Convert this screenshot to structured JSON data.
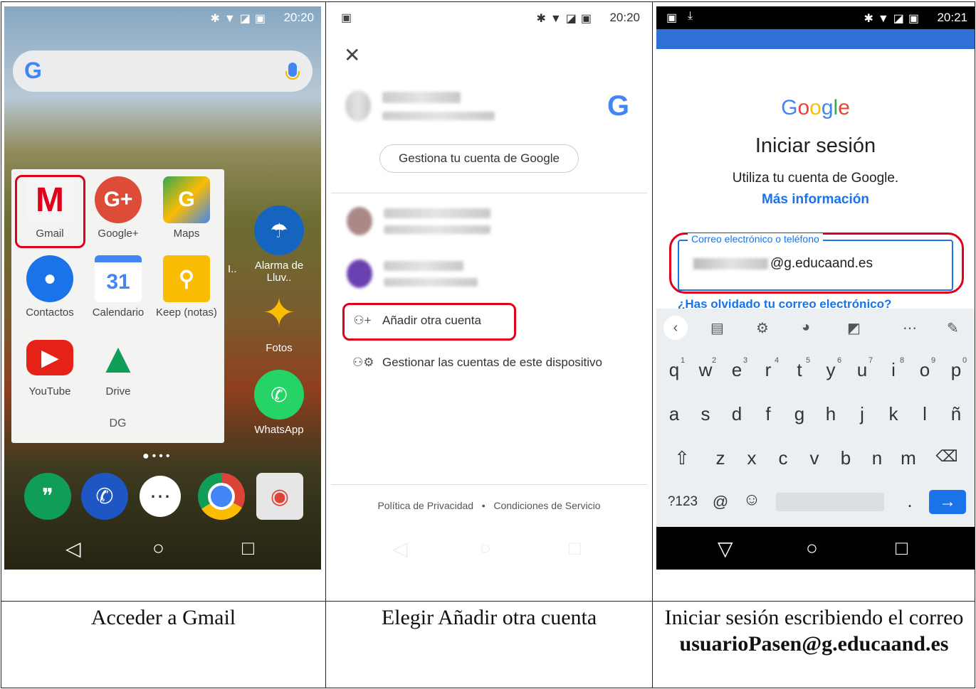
{
  "captions": {
    "c1": "Acceder a Gmail",
    "c2": "Elegir Añadir otra cuenta",
    "c3_line1": "Iniciar sesión escribiendo el correo",
    "c3_line2": "usuarioPasen@g.educaand.es"
  },
  "screen1": {
    "time": "20:20",
    "folder_name": "DG",
    "apps": [
      {
        "label": "Gmail",
        "glyph": "M",
        "color": "#e0e0e0"
      },
      {
        "label": "Google+",
        "glyph": "G+",
        "color": "#dd4b39"
      },
      {
        "label": "Maps",
        "glyph": "G",
        "color": "#34a853"
      },
      {
        "label": "Contactos",
        "glyph": "●",
        "color": "#1a73e8"
      },
      {
        "label": "Calendario",
        "glyph": "31",
        "color": "#4285f4"
      },
      {
        "label": "Keep (notas)",
        "glyph": "💡",
        "color": "#fbbc04"
      },
      {
        "label": "YouTube",
        "glyph": "▶",
        "color": "#e62117"
      },
      {
        "label": "Drive",
        "glyph": "▲",
        "color": "#0f9d58"
      }
    ],
    "side_apps": [
      {
        "label": "Alarma de Lluv..",
        "glyph": "☂",
        "color": "#1565c0"
      },
      {
        "label": "Fotos",
        "glyph": "✦",
        "color": "#ea4335"
      },
      {
        "label": "WhatsApp",
        "glyph": "✆",
        "color": "#25d366"
      }
    ],
    "side_prefix": "I..",
    "dock": [
      {
        "glyph": "❞",
        "color": "#0f9d58"
      },
      {
        "glyph": "✆",
        "color": "#1e56c4"
      },
      {
        "glyph": "⋯",
        "color": "#ffffff"
      },
      {
        "glyph": "◎",
        "color": "#db4437"
      },
      {
        "glyph": "◉",
        "color": "#e6e6e6"
      }
    ]
  },
  "screen2": {
    "time": "20:20",
    "manage_account": "Gestiona tu cuenta de Google",
    "add_account": "Añadir otra cuenta",
    "manage_device": "Gestionar las cuentas de este dispositivo",
    "privacy": "Política de Privacidad",
    "dot": "•",
    "terms": "Condiciones de Servicio"
  },
  "screen3": {
    "time": "20:21",
    "logo": "Google",
    "title": "Iniciar sesión",
    "subtitle": "Utiliza tu cuenta de Google.",
    "more_info": "Más información",
    "field_label": "Correo electrónico o teléfono",
    "field_value": "@g.educaand.es",
    "forgot": "¿Has olvidado tu correo electrónico?",
    "row1": [
      "q",
      "w",
      "e",
      "r",
      "t",
      "y",
      "u",
      "i",
      "o",
      "p"
    ],
    "row1_nums": [
      "1",
      "2",
      "3",
      "4",
      "5",
      "6",
      "7",
      "8",
      "9",
      "0"
    ],
    "row2": [
      "a",
      "s",
      "d",
      "f",
      "g",
      "h",
      "j",
      "k",
      "l",
      "ñ"
    ],
    "row3": [
      "z",
      "x",
      "c",
      "v",
      "b",
      "n",
      "m"
    ],
    "sym_key": "?123",
    "at_key": "@",
    "period_key": "."
  }
}
